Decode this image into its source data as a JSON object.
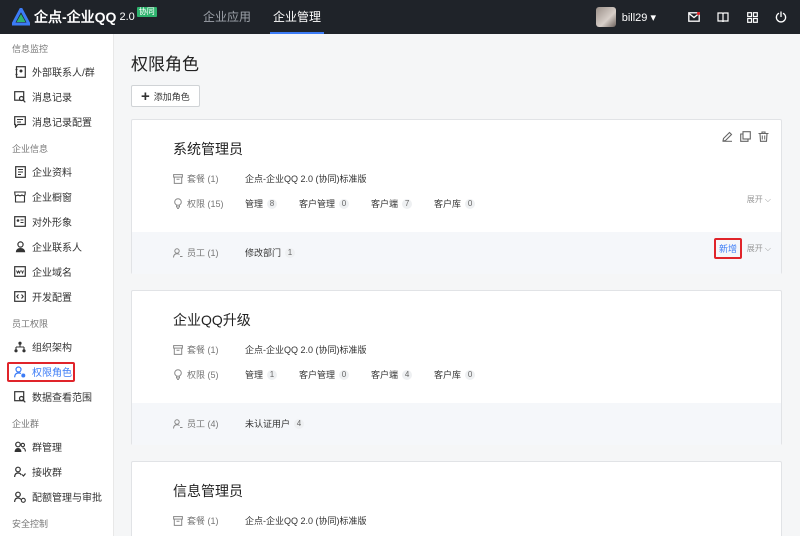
{
  "header": {
    "logo_text": "企点-企业QQ",
    "logo_version": "2.0",
    "logo_badge": "协同",
    "nav": [
      "企业应用",
      "企业管理"
    ],
    "user": "bill29 ▾"
  },
  "sidebar": {
    "groups": [
      {
        "title": "信息监控",
        "items": [
          "外部联系人/群",
          "消息记录",
          "消息记录配置"
        ]
      },
      {
        "title": "企业信息",
        "items": [
          "企业资料",
          "企业橱窗",
          "对外形象",
          "企业联系人",
          "企业域名",
          "开发配置"
        ]
      },
      {
        "title": "员工权限",
        "items": [
          "组织架构",
          "权限角色",
          "数据查看范围"
        ]
      },
      {
        "title": "企业群",
        "items": [
          "群管理",
          "接收群",
          "配额管理与审批"
        ]
      },
      {
        "title": "安全控制",
        "items": []
      }
    ]
  },
  "main": {
    "title": "权限角色",
    "add_label": "添加角色",
    "labels": {
      "package": "套餐",
      "permission": "权限",
      "staff": "员工",
      "expand": "展开 ⌵",
      "new": "新增"
    },
    "roles": [
      {
        "name": "系统管理员",
        "package_count": "(1)",
        "package_value": "企点-企业QQ 2.0 (协同)标准版",
        "perm_count": "(15)",
        "perms": [
          {
            "name": "管理",
            "count": "8"
          },
          {
            "name": "客户管理",
            "count": "0"
          },
          {
            "name": "客户端",
            "count": "7"
          },
          {
            "name": "客户库",
            "count": "0"
          }
        ],
        "staff_count": "(1)",
        "staff_value": "修改部门",
        "staff_num": "1"
      },
      {
        "name": "企业QQ升级",
        "package_count": "(1)",
        "package_value": "企点-企业QQ 2.0 (协同)标准版",
        "perm_count": "(5)",
        "perms": [
          {
            "name": "管理",
            "count": "1"
          },
          {
            "name": "客户管理",
            "count": "0"
          },
          {
            "name": "客户端",
            "count": "4"
          },
          {
            "name": "客户库",
            "count": "0"
          }
        ],
        "staff_count": "(4)",
        "staff_value": "未认证用户",
        "staff_num": "4"
      },
      {
        "name": "信息管理员",
        "package_count": "(1)",
        "package_value": "企点-企业QQ 2.0 (协同)标准版"
      }
    ]
  }
}
